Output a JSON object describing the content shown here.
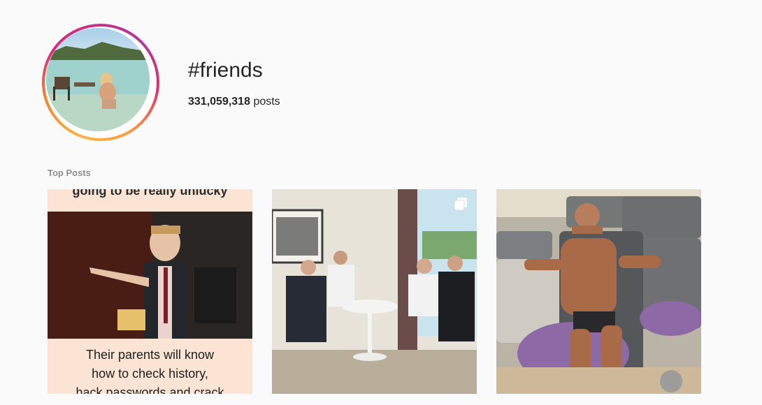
{
  "header": {
    "hashtag": "#friends",
    "post_count": "331,059,318",
    "post_count_suffix": "posts"
  },
  "avatar": {
    "description_icon": "hashtag-top-post-photo"
  },
  "section": {
    "title": "Top Posts"
  },
  "posts": [
    {
      "type": "image",
      "top_text": "going to be really unlucky",
      "bottom_text": [
        "Their parents will know",
        "how to check history,",
        "hack passwords and crack"
      ]
    },
    {
      "type": "carousel",
      "icon": "multiple-posts-icon"
    },
    {
      "type": "image"
    }
  ]
}
